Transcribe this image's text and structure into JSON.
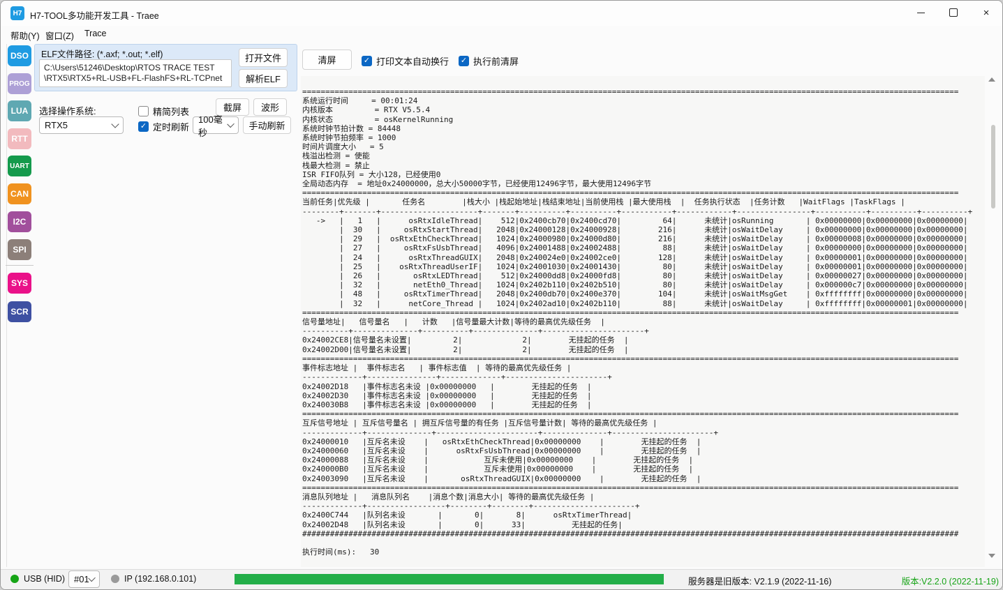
{
  "window": {
    "title": "H7-TOOL多功能开发工具 - Traee",
    "icon_text": "H7",
    "icon_color": "#1f9be2"
  },
  "menu": {
    "help": "帮助(Y)",
    "window": "窗口(Z)",
    "trace": "Trace"
  },
  "sidebar": {
    "items": [
      {
        "label": "DSO",
        "color": "#1f9be2"
      },
      {
        "label": "PROG",
        "color": "#ada0d6"
      },
      {
        "label": "LUA",
        "color": "#5fa8b2"
      },
      {
        "label": "RTT",
        "color": "#f2babe"
      },
      {
        "label": "UART",
        "color": "#149a4c"
      },
      {
        "label": "CAN",
        "color": "#f0921f"
      },
      {
        "label": "I2C",
        "color": "#a14f9c"
      },
      {
        "label": "SPI",
        "color": "#8c7f79"
      },
      {
        "label": "SYS",
        "color": "#ea1189"
      },
      {
        "label": "SCR",
        "color": "#3e50a2"
      }
    ]
  },
  "elf_panel": {
    "label": "ELF文件路径:  (*.axf; *.out; *.elf)",
    "path_line1": "C:\\Users\\51246\\Desktop\\RTOS TRACE TEST",
    "path_line2": "\\RTX5\\RTX5+RL-USB+FL-FlashFS+RL-TCPnet",
    "open_button": "打开文件",
    "parse_button": "解析ELF"
  },
  "os_panel": {
    "label": "选择操作系统:",
    "os_selected": "RTX5",
    "simple_list_label": "精简列表",
    "timer_refresh_label": "定时刷新",
    "interval_selected": "100毫秒",
    "screenshot_button": "截屏",
    "waveform_button": "波形",
    "manual_refresh_button": "手动刷新"
  },
  "console_toolbar": {
    "clear_button": "清屏",
    "wrap_label": "打印文本自动换行",
    "clear_before_label": "执行前清屏"
  },
  "ui": {
    "accent": "#0b67c4"
  },
  "console": {
    "lines": [
      "==============================================================================================================================================",
      "系统运行时间     = 00:01:24",
      "内核版本         = RTX V5.5.4",
      "内核状态         = osKernelRunning",
      "系统时钟节拍计数 = 84448",
      "系统时钟节拍频率 = 1000",
      "时间片调度大小   = 5",
      "栈溢出检测 = 使能",
      "栈最大检测 = 禁止",
      "ISR FIFO队列 = 大小128，已经使用0",
      "全局动态内存  = 地址0x24000000，总大小50000字节，已经使用12496字节，最大使用12496字节",
      "==============================================================================================================================================",
      "当前任务|优先级 |       任务名        |栈大小 |栈起始地址|栈结束地址|当前使用栈 |最大使用栈  |  任务执行状态  |任务计数   |WaitFlags |TaskFlags |",
      "--------+-------+---------------------+-------+----------+----------+-----------+------------+----------------+-----------+----------+----------+",
      "   ->   |   1   |      osRtxIdleThread|    512|0x2400cb70|0x2400cd70|         64|      未统计|osRunning       | 0x00000000|0x00000000|0x00000000|",
      "        |  30   |     osRtxStartThread|   2048|0x24000128|0x24000928|        216|      未统计|osWaitDelay     | 0x00000000|0x00000000|0x00000000|",
      "        |  29   |  osRtxEthCheckThread|   1024|0x24000980|0x24000d80|        216|      未统计|osWaitDelay     | 0x00000008|0x00000000|0x00000000|",
      "        |  27   |     osRtxFsUsbThread|   4096|0x24001488|0x24002488|         88|      未统计|osWaitDelay     | 0x00000000|0x00000000|0x00000000|",
      "        |  24   |      osRtxThreadGUIX|   2048|0x240024e0|0x24002ce0|        128|      未统计|osWaitDelay     | 0x00000001|0x00000000|0x00000000|",
      "        |  25   |    osRtxThreadUserIF|   1024|0x24001030|0x24001430|         80|      未统计|osWaitDelay     | 0x00000001|0x00000000|0x00000000|",
      "        |  26   |       osRtxLEDThread|    512|0x24000dd8|0x24000fd8|         80|      未统计|osWaitDelay     | 0x00000027|0x00000000|0x00000000|",
      "        |  32   |       netEth0_Thread|   1024|0x2402b110|0x2402b510|         80|      未统计|osWaitDelay     | 0x000000c7|0x00000000|0x00000000|",
      "        |  48   |     osRtxTimerThread|   2048|0x2400db70|0x2400e370|        104|      未统计|osWaitMsgGet    | 0xffffffff|0x00000000|0x00000000|",
      "        |  32   |      netCore_Thread |   1024|0x2402ad10|0x2402b110|         88|      未统计|osWaitDelay     | 0xffffffff|0x00000001|0x00000000|",
      "==============================================================================================================================================",
      "信号量地址|   信号量名   |   计数   |信号量最大计数|等待的最高优先级任务  |",
      "----------+--------------+----------+--------------+----------------------+",
      "0x24002CE8|信号量名未设置|         2|             2|        无挂起的任务  |",
      "0x24002D00|信号量名未设置|         2|             2|        无挂起的任务  |",
      "==============================================================================================================================================",
      "事件标志地址 |  事件标志名   | 事件标志值  | 等待的最高优先级任务 |",
      "-------------+---------------+-------------+----------------------+",
      "0x24002D18   |事件标志名未设 |0x00000000   |        无挂起的任务  |",
      "0x24002D30   |事件标志名未设 |0x00000000   |        无挂起的任务  |",
      "0x240030B8   |事件标志名未设 |0x00000000   |        无挂起的任务  |",
      "==============================================================================================================================================",
      "互斥信号地址 | 互斥信号量名 | 拥互斥信号量的有任务 |互斥信号量计数| 等待的最高优先级任务 |",
      "-------------+--------------+----------------------+--------------+----------------------+",
      "0x24000010   |互斥名未设    |   osRtxEthCheckThread|0x00000000    |        无挂起的任务  |",
      "0x24000060   |互斥名未设    |      osRtxFsUsbThread|0x00000000    |        无挂起的任务  |",
      "0x24000088   |互斥名未设    |            互斥未使用|0x00000000    |        无挂起的任务  |",
      "0x240000B0   |互斥名未设    |            互斥未使用|0x00000000    |        无挂起的任务  |",
      "0x24003090   |互斥名未设    |       osRtxThreadGUIX|0x00000000    |        无挂起的任务  |",
      "==============================================================================================================================================",
      "消息队列地址 |   消息队列名    |消息个数|消息大小| 等待的最高优先级任务 |",
      "-------------+-----------------+--------+--------+----------------------+",
      "0x2400C744   |队列名未设       |       0|       8|      osRtxTimerThread|",
      "0x24002D48   |队列名未设       |       0|      33|          无挂起的任务|",
      "##############################################################################################################################################",
      "",
      "执行时间(ms):   30"
    ]
  },
  "status_bar": {
    "usb_label": "USB (HID)",
    "usb_dot_color": "#16a416",
    "device_selected": "#01",
    "ip_label": "IP (192.168.0.101)",
    "ip_dot_color": "#9a9a9a",
    "progress_color": "#23ae49",
    "server_version": "服务器是旧版本: V2.1.9 (2022-11-16)",
    "app_version": "版本:V2.2.0 (2022-11-19)",
    "app_version_color": "#18a418"
  }
}
